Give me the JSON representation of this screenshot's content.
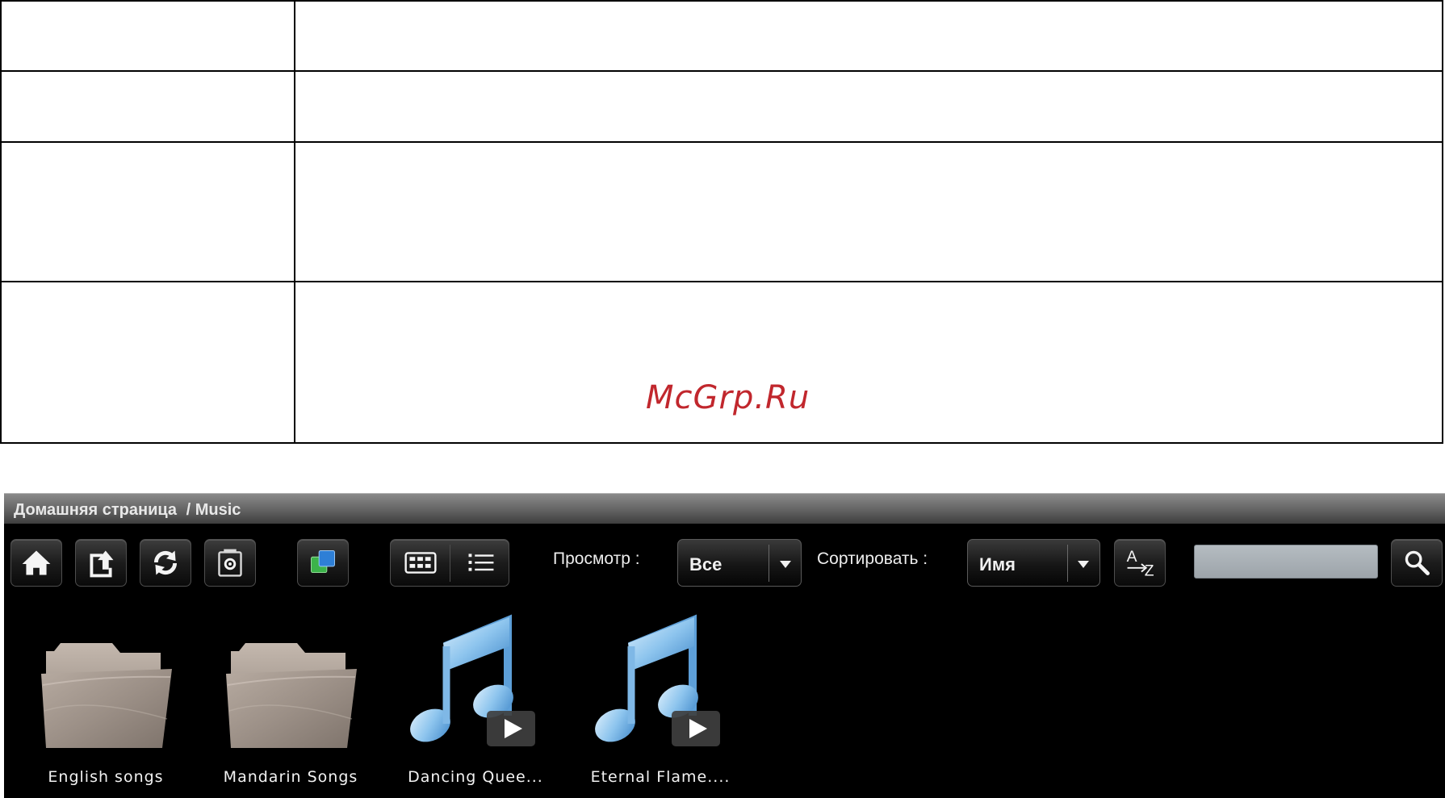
{
  "watermark": "McGrp.Ru",
  "breadcrumb": {
    "home": "Домашняя страница",
    "path": "/ Music"
  },
  "toolbar": {
    "icons": [
      "home-icon",
      "upload-icon",
      "refresh-icon",
      "settings-icon",
      "select-icon",
      "grid-view-icon",
      "list-view-icon",
      "sort-az-icon",
      "search-icon"
    ],
    "view_label": "Просмотр :",
    "view_value": "Все",
    "sort_label": "Сортировать :",
    "sort_value": "Имя",
    "search_value": ""
  },
  "items": [
    {
      "name": "English songs",
      "type": "folder"
    },
    {
      "name": "Mandarin Songs",
      "type": "folder"
    },
    {
      "name": "Dancing Quee...",
      "type": "audio"
    },
    {
      "name": "Eternal Flame....",
      "type": "audio"
    }
  ],
  "colors": {
    "panel_bg": "#000000",
    "watermark": "#c1272d",
    "note": "#7fb8e6",
    "folder": "#9f9287"
  }
}
